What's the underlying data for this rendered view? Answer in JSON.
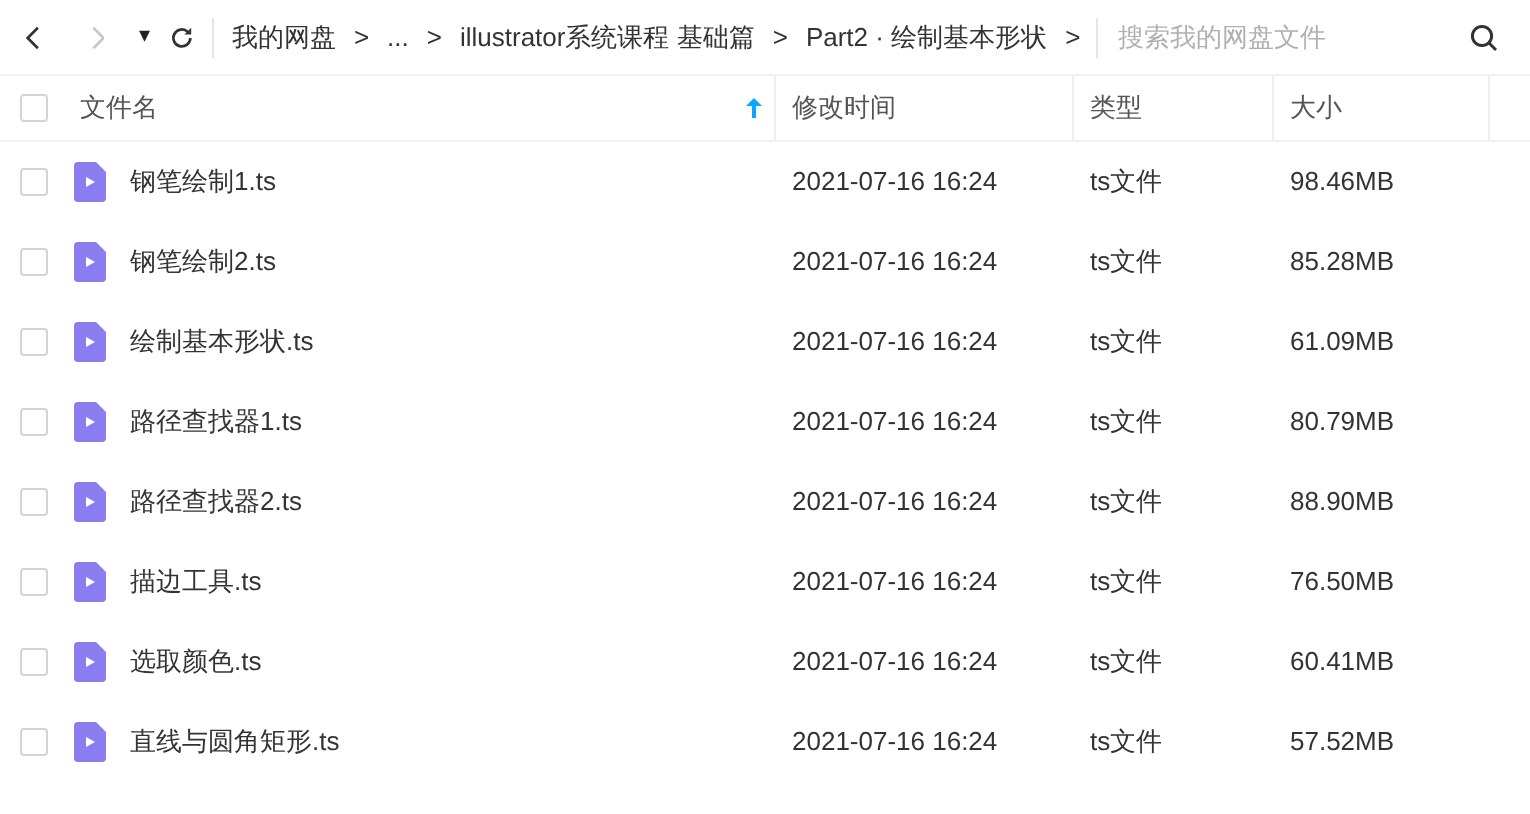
{
  "toolbar": {
    "dropdown": "▾",
    "breadcrumbs": [
      {
        "label": "我的网盘"
      },
      {
        "label": "..."
      },
      {
        "label": "illustrator系统课程 基础篇"
      },
      {
        "label": "Part2 · 绘制基本形状"
      }
    ],
    "separator": ">",
    "search": {
      "placeholder": "搜索我的网盘文件"
    }
  },
  "table": {
    "select_all": {
      "checked": false
    },
    "columns": [
      {
        "label": "文件名",
        "sorted": true
      },
      {
        "label": "修改时间",
        "sorted": false
      },
      {
        "label": "类型",
        "sorted": false
      },
      {
        "label": "大小",
        "sorted": false
      }
    ],
    "rows": [
      {
        "checked": false,
        "name": "钢笔绘制1.ts",
        "modified": "2021-07-16 16:24",
        "type": "ts文件",
        "size": "98.46MB"
      },
      {
        "checked": false,
        "name": "钢笔绘制2.ts",
        "modified": "2021-07-16 16:24",
        "type": "ts文件",
        "size": "85.28MB"
      },
      {
        "checked": false,
        "name": "绘制基本形状.ts",
        "modified": "2021-07-16 16:24",
        "type": "ts文件",
        "size": "61.09MB"
      },
      {
        "checked": false,
        "name": "路径查找器1.ts",
        "modified": "2021-07-16 16:24",
        "type": "ts文件",
        "size": "80.79MB"
      },
      {
        "checked": false,
        "name": "路径查找器2.ts",
        "modified": "2021-07-16 16:24",
        "type": "ts文件",
        "size": "88.90MB"
      },
      {
        "checked": false,
        "name": "描边工具.ts",
        "modified": "2021-07-16 16:24",
        "type": "ts文件",
        "size": "76.50MB"
      },
      {
        "checked": false,
        "name": "选取颜色.ts",
        "modified": "2021-07-16 16:24",
        "type": "ts文件",
        "size": "60.41MB"
      },
      {
        "checked": false,
        "name": "直线与圆角矩形.ts",
        "modified": "2021-07-16 16:24",
        "type": "ts文件",
        "size": "57.52MB"
      }
    ]
  }
}
